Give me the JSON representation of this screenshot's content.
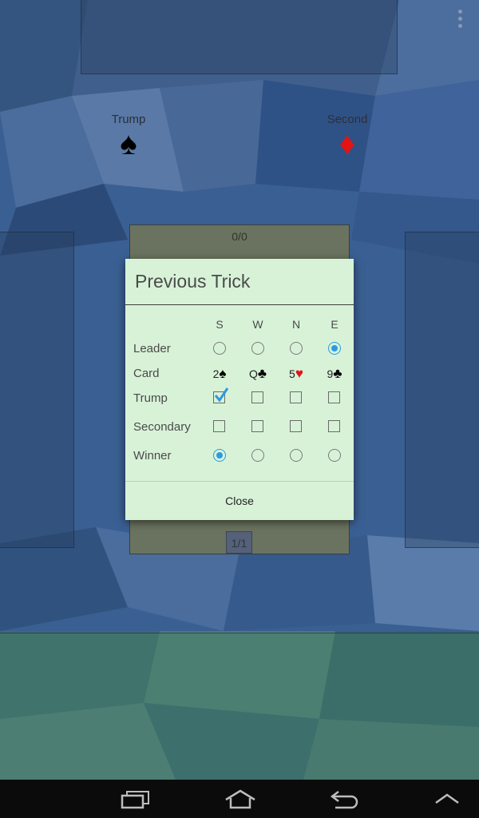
{
  "board": {
    "trump_label": "Trump",
    "trump_suit": "♠",
    "second_label": "Second",
    "second_suit": "♦",
    "trick_count": "0/0",
    "page_indicator": "1/1"
  },
  "dialog": {
    "title": "Previous Trick",
    "columns": [
      "S",
      "W",
      "N",
      "E"
    ],
    "rows": {
      "leader": "Leader",
      "card": "Card",
      "trump": "Trump",
      "secondary": "Secondary",
      "winner": "Winner"
    },
    "leader": "E",
    "cards": [
      {
        "rank": "2",
        "suit": "♠",
        "color": "#000000"
      },
      {
        "rank": "Q",
        "suit": "♣",
        "color": "#000000"
      },
      {
        "rank": "5",
        "suit": "♥",
        "color": "#e31414"
      },
      {
        "rank": "9",
        "suit": "♣",
        "color": "#000000"
      }
    ],
    "trump_checked": [
      true,
      false,
      false,
      false
    ],
    "secondary_checked": [
      false,
      false,
      false,
      false
    ],
    "winner": "S",
    "close_label": "Close"
  },
  "colors": {
    "background": "#3a5f92",
    "dialog_bg": "#d8f2d8",
    "accent": "#2d9ae0",
    "diamond_red": "#e31414"
  },
  "navbar": {
    "icons": [
      "recent-apps-icon",
      "home-icon",
      "back-icon",
      "up-chevron-icon"
    ]
  }
}
